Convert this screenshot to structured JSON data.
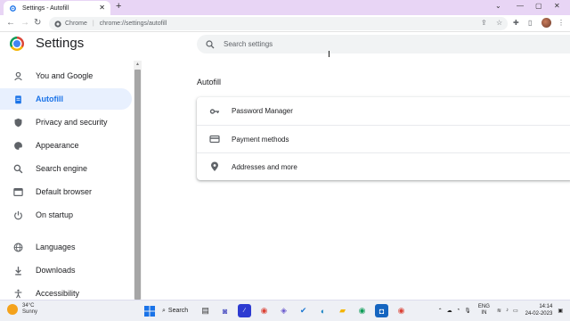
{
  "browser": {
    "tab_title": "Settings - Autofill",
    "omnibox_chip": "Chrome",
    "url": "chrome://settings/autofill"
  },
  "header": {
    "title": "Settings",
    "search_placeholder": "Search settings"
  },
  "sidebar": {
    "items": [
      {
        "label": "You and Google",
        "icon": "person-icon"
      },
      {
        "label": "Autofill",
        "icon": "clipboard-icon",
        "active": true
      },
      {
        "label": "Privacy and security",
        "icon": "shield-icon"
      },
      {
        "label": "Appearance",
        "icon": "palette-icon"
      },
      {
        "label": "Search engine",
        "icon": "search-icon"
      },
      {
        "label": "Default browser",
        "icon": "browser-icon"
      },
      {
        "label": "On startup",
        "icon": "power-icon"
      },
      {
        "label": "Languages",
        "icon": "globe-icon"
      },
      {
        "label": "Downloads",
        "icon": "download-icon"
      },
      {
        "label": "Accessibility",
        "icon": "accessibility-icon"
      }
    ]
  },
  "main": {
    "section_title": "Autofill",
    "rows": [
      {
        "label": "Password Manager",
        "icon": "key-icon"
      },
      {
        "label": "Payment methods",
        "icon": "credit-card-icon"
      },
      {
        "label": "Addresses and more",
        "icon": "location-pin-icon"
      }
    ]
  },
  "taskbar": {
    "weather_temp": "34°C",
    "weather_desc": "Sunny",
    "search_label": "Search",
    "lang_line1": "ENG",
    "lang_line2": "IN",
    "time": "14:14",
    "date": "24-02-2023"
  },
  "colors": {
    "titlebar": "#e8d5f5",
    "accent": "#1a73e8",
    "active_bg": "#e8f0fe"
  }
}
